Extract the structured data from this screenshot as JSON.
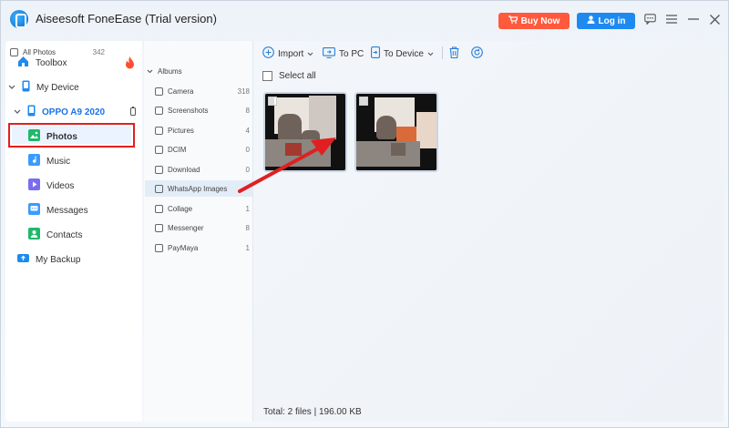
{
  "app": {
    "title": "Aiseesoft FoneEase (Trial version)",
    "buy_now": "Buy Now",
    "log_in": "Log in"
  },
  "sidebar": {
    "toolbox": "Toolbox",
    "my_device": "My Device",
    "device_name": "OPPO A9 2020",
    "items": [
      {
        "label": "Photos",
        "icon": "photos-icon",
        "selected": true
      },
      {
        "label": "Music",
        "icon": "music-icon"
      },
      {
        "label": "Videos",
        "icon": "videos-icon"
      },
      {
        "label": "Messages",
        "icon": "messages-icon"
      },
      {
        "label": "Contacts",
        "icon": "contacts-icon"
      }
    ],
    "my_backup": "My Backup"
  },
  "albums": {
    "all_photos": {
      "label": "All Photos",
      "count": "342"
    },
    "albums_label": "Albums",
    "list": [
      {
        "label": "Camera",
        "count": "318"
      },
      {
        "label": "Screenshots",
        "count": "8"
      },
      {
        "label": "Pictures",
        "count": "4"
      },
      {
        "label": "DCIM",
        "count": "0"
      },
      {
        "label": "Download",
        "count": "0"
      },
      {
        "label": "WhatsApp Images",
        "count": "",
        "selected": true
      },
      {
        "label": "Collage",
        "count": "1"
      },
      {
        "label": "Messenger",
        "count": "8"
      },
      {
        "label": "PayMaya",
        "count": "1"
      }
    ]
  },
  "toolbar": {
    "import": "Import",
    "to_pc": "To PC",
    "to_device": "To Device"
  },
  "main": {
    "select_all": "Select all",
    "total": "Total: 2 files | 196.00 KB"
  },
  "colors": {
    "accent": "#1e8af0",
    "buy": "#ff5a3d",
    "highlight_red": "#e02020"
  }
}
